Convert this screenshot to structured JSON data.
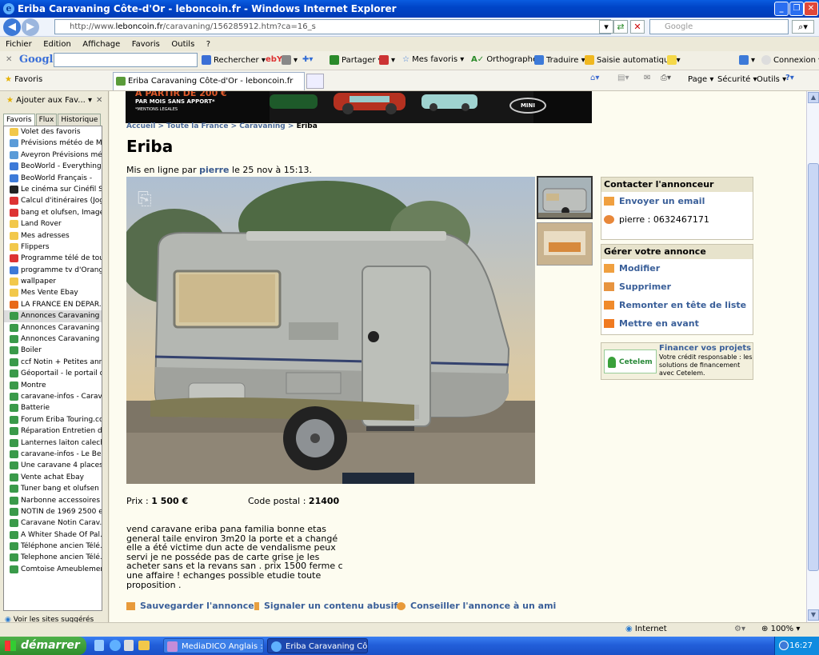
{
  "window": {
    "title": "Eriba Caravaning Côte-d'Or - leboncoin.fr - Windows Internet Explorer"
  },
  "address": {
    "url_prefix": "http://www.",
    "url_domain": "leboncoin.fr",
    "url_rest": "/caravaning/156285912.htm?ca=16_s",
    "search_placeholder": "Google"
  },
  "menu": [
    "Fichier",
    "Edition",
    "Affichage",
    "Favoris",
    "Outils",
    "?"
  ],
  "google_toolbar": {
    "logo": "Google",
    "rechercher": "Rechercher",
    "partager": "Partager",
    "mes_favoris": "Mes favoris",
    "orthographe": "Orthographe",
    "traduire": "Traduire",
    "saisie": "Saisie automatique",
    "connexion": "Connexion"
  },
  "favbar": {
    "favoris": "Favoris",
    "tab_title": "Eriba Caravaning Côte-d'Or - leboncoin.fr",
    "page": "Page",
    "securite": "Sécurité",
    "outils": "Outils"
  },
  "sidebar": {
    "add_label": "Ajouter aux Fav...",
    "tabs": [
      "Favoris",
      "Flux",
      "Historique"
    ],
    "items": [
      "Volet des favoris",
      "Prévisions météo de M...",
      "Aveyron Prévisions mé...",
      "BeoWorld - Everything ...",
      "BeoWorld Français -",
      "Le cinéma sur Cinéfil S...",
      "Calcul d'itinéraires (Jog...",
      "bang et olufsen, Image...",
      "Land Rover",
      "Mes adresses",
      "Flippers",
      "Programme télé de tou...",
      "programme tv d'Orange",
      "wallpaper",
      "Mes Vente Ebay",
      "LA FRANCE EN DEPAR...",
      "Annonces Caravaning ...",
      "Annonces Caravaning ...",
      "Annonces Caravaning ...",
      "Boiler",
      "ccf Notin + Petites ann...",
      "Géoportail - le portail d...",
      "Montre",
      "caravane-infos - Carav...",
      "Batterie",
      "Forum Eriba Touring.co...",
      "Réparation Entretien d'...",
      "Lanternes laiton calech...",
      "caravane-infos - Le Be...",
      "Une caravane 4 places ...",
      "Vente achat Ebay",
      "Tuner bang et olufsen ...",
      "Narbonne accessoires",
      "NOTIN de 1969 2500 e...",
      "Caravane Notin Carav...",
      "A Whiter Shade Of Pal...",
      "Téléphone ancien Télé...",
      "Telephone ancien Télé...",
      "Comtoise Ameublement..."
    ],
    "selected_index": 16,
    "bottom": "Voir les sites suggérés"
  },
  "banner": {
    "line1": "A PARTIR DE 200 €",
    "line2": "PAR MOIS SANS APPORT*",
    "line3": "*MENTIONS LEGALES",
    "brand": "MINI"
  },
  "breadcrumb": {
    "accueil": "Accueil",
    "sep": ">",
    "france": "Toute la France",
    "caravaning": "Caravaning",
    "current": "Eriba"
  },
  "ad": {
    "title": "Eriba",
    "posted_prefix": "Mis en ligne par",
    "author": "pierre",
    "posted_suffix": "le 25 nov à 15:13.",
    "price_label": "Prix :",
    "price": "1 500 €",
    "cp_label": "Code postal :",
    "cp": "21400",
    "description": "vend caravane eriba pana familia bonne etas general taile environ 3m20 la porte et a changé elle a été victime dun acte de vendalisme peux servi je ne posséde pas de carte grise je les acheter sans et la revans san . prix 1500 ferme c une affaire ! echanges possible etudie toute proposition ."
  },
  "contact": {
    "header": "Contacter l'annonceur",
    "email": "Envoyer un email",
    "phone": "pierre : 0632467171"
  },
  "manage": {
    "header": "Gérer votre annonce",
    "modifier": "Modifier",
    "supprimer": "Supprimer",
    "remonter": "Remonter en tête de liste",
    "avant": "Mettre en avant"
  },
  "cetelem": {
    "logo": "Cetelem",
    "title": "Financer vos projets",
    "text": "Votre crédit responsable : les solutions de financement avec Cetelem."
  },
  "actions": {
    "save": "Sauvegarder l'annonce",
    "report": "Signaler un contenu abusif",
    "advise": "Conseiller l'annonce à un ami"
  },
  "status": {
    "zone": "Internet",
    "zoom": "100%"
  },
  "taskbar": {
    "start": "démarrer",
    "task1": "MediaDICO Anglais : ...",
    "task2": "Eriba Caravaning Côt...",
    "time": "16:27"
  }
}
